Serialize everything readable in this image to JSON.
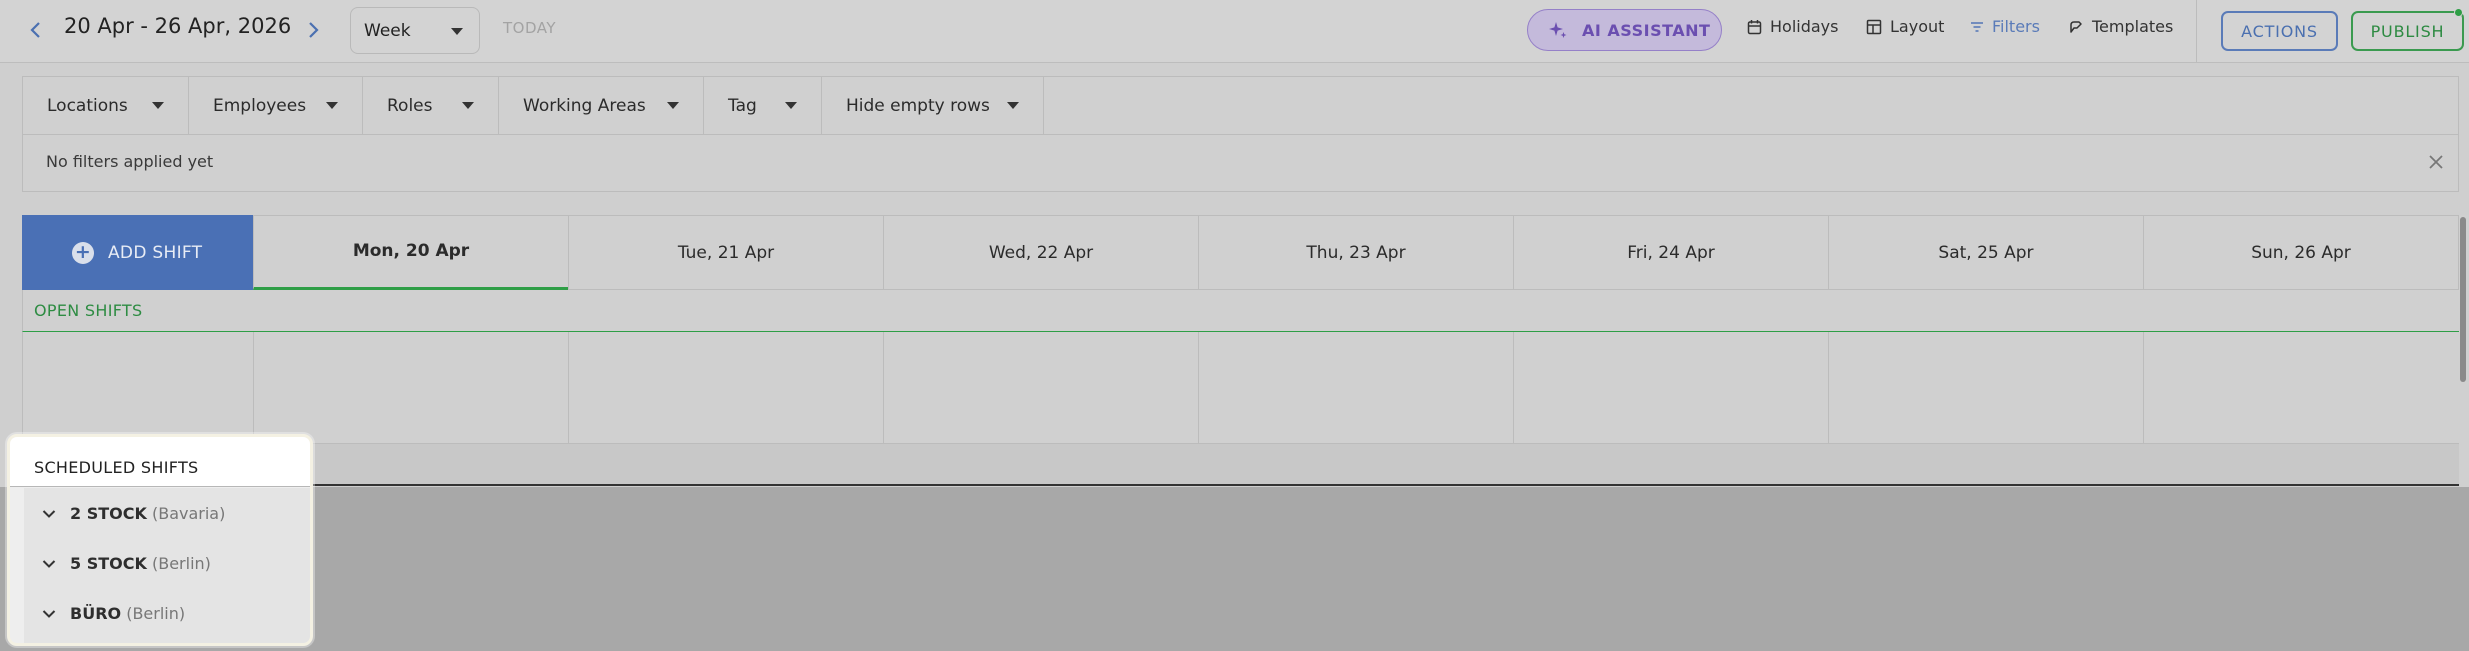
{
  "toolbar": {
    "date_range": "20 Apr - 26 Apr, 2026",
    "view_select": "Week",
    "today_label": "TODAY",
    "ai_assistant_label": "AI ASSISTANT",
    "holidays_label": "Holidays",
    "layout_label": "Layout",
    "filters_label": "Filters",
    "templates_label": "Templates",
    "actions_label": "ACTIONS",
    "publish_label": "PUBLISH"
  },
  "filters": {
    "tabs": [
      {
        "label": "Locations"
      },
      {
        "label": "Employees"
      },
      {
        "label": "Roles"
      },
      {
        "label": "Working Areas"
      },
      {
        "label": "Tag"
      },
      {
        "label": "Hide empty rows"
      }
    ],
    "status_text": "No filters applied yet"
  },
  "schedule": {
    "add_shift_label": "ADD SHIFT",
    "days": [
      {
        "label": "Mon, 20 Apr"
      },
      {
        "label": "Tue, 21 Apr"
      },
      {
        "label": "Wed, 22 Apr"
      },
      {
        "label": "Thu, 23 Apr"
      },
      {
        "label": "Fri, 24 Apr"
      },
      {
        "label": "Sat, 25 Apr"
      },
      {
        "label": "Sun, 26 Apr"
      }
    ],
    "open_shifts_label": "OPEN SHIFTS",
    "scheduled_shifts_label": "SCHEDULED SHIFTS",
    "locations": [
      {
        "name": "2 STOCK",
        "region": "(Bavaria)"
      },
      {
        "name": "5 STOCK",
        "region": "(Berlin)"
      },
      {
        "name": "BÜRO",
        "region": "(Berlin)"
      }
    ]
  },
  "colors": {
    "accent_blue": "#4a70b5",
    "accent_green": "#2e9e46",
    "ai_purple": "#6b4fb0"
  },
  "icons": [
    "chevron-left-icon",
    "chevron-right-icon",
    "caret-down-icon",
    "sparkle-icon",
    "calendar-icon",
    "layout-icon",
    "filter-icon",
    "templates-icon",
    "close-icon",
    "plus-icon",
    "chevron-down-icon"
  ]
}
